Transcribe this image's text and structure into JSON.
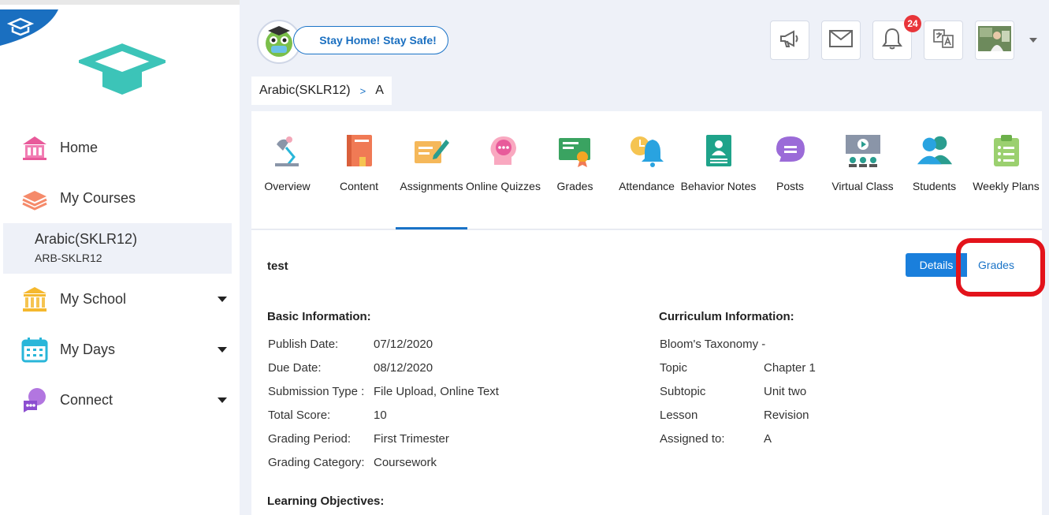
{
  "sidebar": {
    "nav": [
      {
        "label": "Home",
        "icon": "home-icon"
      },
      {
        "label": "My Courses",
        "icon": "courses-icon"
      },
      {
        "label": "My School",
        "icon": "school-icon"
      },
      {
        "label": "My Days",
        "icon": "calendar-icon"
      },
      {
        "label": "Connect",
        "icon": "connect-icon"
      }
    ],
    "active_course": {
      "name": "Arabic(SKLR12)",
      "code": "ARB-SKLR12"
    }
  },
  "header": {
    "banner": "Stay Home! Stay Safe!",
    "notification_count": "24"
  },
  "breadcrumb": {
    "course": "Arabic(SKLR12)",
    "separator": ">",
    "section": "A"
  },
  "tabs": [
    {
      "label": "Overview"
    },
    {
      "label": "Content"
    },
    {
      "label": "Assignments"
    },
    {
      "label": "Online Quizzes"
    },
    {
      "label": "Grades"
    },
    {
      "label": "Attendance"
    },
    {
      "label": "Behavior Notes"
    },
    {
      "label": "Posts"
    },
    {
      "label": "Virtual Class"
    },
    {
      "label": "Students"
    },
    {
      "label": "Weekly Plans"
    }
  ],
  "assignment": {
    "title": "test",
    "details_button": "Details",
    "grades_button": "Grades",
    "basic_heading": "Basic Information:",
    "basic": [
      {
        "label": "Publish Date:",
        "value": "07/12/2020"
      },
      {
        "label": "Due Date:",
        "value": "08/12/2020"
      },
      {
        "label": "Submission Type :",
        "value": "File Upload, Online Text"
      },
      {
        "label": "Total Score:",
        "value": "10"
      },
      {
        "label": "Grading Period:",
        "value": "First Trimester"
      },
      {
        "label": "Grading Category:",
        "value": "Coursework"
      }
    ],
    "curriculum_heading": "Curriculum Information:",
    "curriculum": [
      {
        "label": "Bloom's Taxonomy -",
        "value": ""
      },
      {
        "label": "Topic",
        "value": "Chapter 1"
      },
      {
        "label": "Subtopic",
        "value": "Unit two"
      },
      {
        "label": "Lesson",
        "value": "Revision"
      },
      {
        "label": "Assigned to:",
        "value": "A"
      }
    ],
    "objectives_heading": "Learning Objectives:"
  },
  "colors": {
    "accent": "#1a7fdc",
    "highlight": "#e3131b"
  }
}
